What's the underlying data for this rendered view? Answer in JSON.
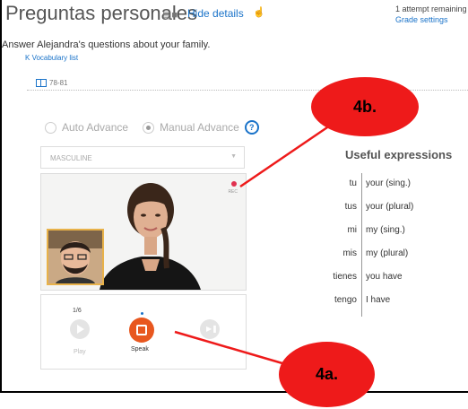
{
  "header": {
    "title": "Preguntas personales",
    "hide_details": "Hide details",
    "attempts": "1 attempt remaining",
    "grade_settings": "Grade settings"
  },
  "instructions": "Answer Alejandra's questions about your family.",
  "vocab_link": "Vocabulary list",
  "pages": "78-81",
  "mode": {
    "auto": "Auto Advance",
    "manual": "Manual Advance",
    "selected": "Manual Advance"
  },
  "dropdown": {
    "value": "MASCULINE"
  },
  "video": {
    "rec_label": "REC"
  },
  "controls": {
    "counter": "1/6",
    "play": "Play",
    "speak": "Speak",
    "next": ""
  },
  "useful": {
    "title": "Useful expressions",
    "rows": [
      {
        "es": "tu",
        "en": "your (sing.)"
      },
      {
        "es": "tus",
        "en": "your (plural)"
      },
      {
        "es": "mi",
        "en": "my (sing.)"
      },
      {
        "es": "mis",
        "en": "my (plural)"
      },
      {
        "es": "tienes",
        "en": "you have"
      },
      {
        "es": "tengo",
        "en": "I have"
      }
    ]
  },
  "annotations": {
    "top": "4b.",
    "bottom": "4a."
  },
  "colors": {
    "accent": "#1a73c9",
    "speak": "#e8571f",
    "callout": "#ee1a1a",
    "rec": "#e0304f",
    "pip_border": "#e8b24a"
  },
  "icons": [
    "rubric-icon",
    "notebook-icon",
    "pin-icon",
    "collapse-icon",
    "book-icon",
    "help-icon",
    "chevron-down-icon",
    "rec-icon",
    "play-icon",
    "stop-icon",
    "next-icon"
  ]
}
